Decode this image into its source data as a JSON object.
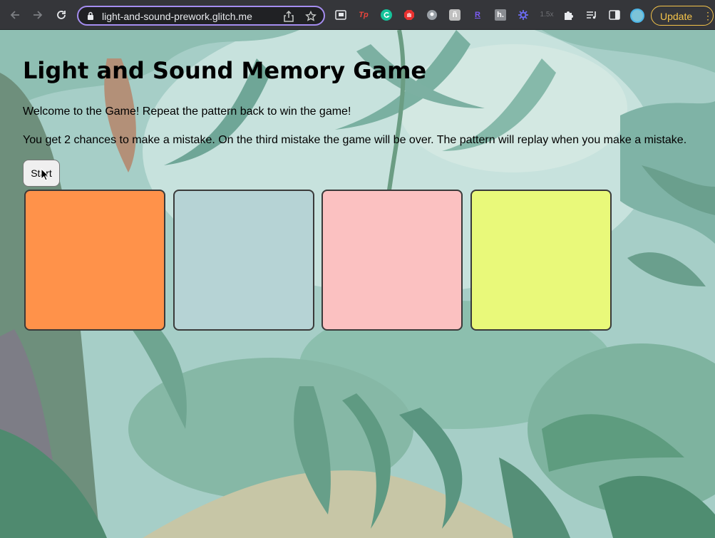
{
  "browser": {
    "url": "light-and-sound-prework.glitch.me",
    "update_label": "Update",
    "extensions": [
      "Tp",
      "R",
      "h.",
      "1.5x"
    ]
  },
  "page": {
    "title": "Light and Sound Memory Game",
    "welcome": "Welcome to the Game! Repeat the pattern back to win the game!",
    "rules": "You get 2 chances to make a mistake. On the third mistake the game will be over. The pattern will replay when you make a mistake.",
    "start_label": "Start"
  },
  "colors": {
    "pad1": "#ff924a",
    "pad2": "#b6d3d5",
    "pad3": "#fbc1c1",
    "pad4": "#e9f97a",
    "omnibox_border": "#a58df0",
    "update": "#f5c44a"
  }
}
